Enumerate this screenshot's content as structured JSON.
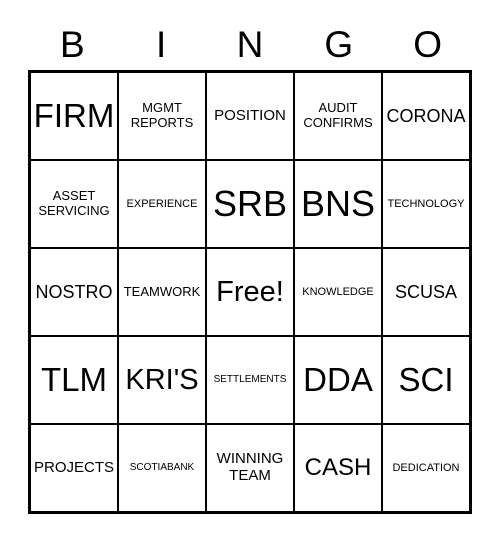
{
  "card": {
    "title": "BINGO",
    "header_letters": [
      "B",
      "I",
      "N",
      "G",
      "O"
    ],
    "free_space_label": "Free!",
    "colors": {
      "background": "#ffffff",
      "border": "#000000",
      "text": "#000000"
    },
    "grid": {
      "columns": 5,
      "rows": 5,
      "cells": [
        {
          "label": "FIRM",
          "size": "fs-4xl",
          "column": "B",
          "row": 1
        },
        {
          "label": "MGMT\nREPORTS",
          "size": "fs-md",
          "column": "I",
          "row": 1
        },
        {
          "label": "POSITION",
          "size": "fs-lg",
          "column": "N",
          "row": 1
        },
        {
          "label": "AUDIT\nCONFIRMS",
          "size": "fs-md",
          "column": "G",
          "row": 1
        },
        {
          "label": "CORONA",
          "size": "fs-xl",
          "column": "O",
          "row": 1
        },
        {
          "label": "ASSET\nSERVICING",
          "size": "fs-md",
          "column": "B",
          "row": 2
        },
        {
          "label": "EXPERIENCE",
          "size": "fs-sm",
          "column": "I",
          "row": 2
        },
        {
          "label": "SRB",
          "size": "fs-5xl",
          "column": "N",
          "row": 2
        },
        {
          "label": "BNS",
          "size": "fs-5xl",
          "column": "G",
          "row": 2
        },
        {
          "label": "TECHNOLOGY",
          "size": "fs-sm",
          "column": "O",
          "row": 2
        },
        {
          "label": "NOSTRO",
          "size": "fs-xl",
          "column": "B",
          "row": 3
        },
        {
          "label": "TEAMWORK",
          "size": "fs-md",
          "column": "I",
          "row": 3
        },
        {
          "label": "Free!",
          "size": "fs-3xl",
          "column": "N",
          "row": 3
        },
        {
          "label": "KNOWLEDGE",
          "size": "fs-sm",
          "column": "G",
          "row": 3
        },
        {
          "label": "SCUSA",
          "size": "fs-xl",
          "column": "O",
          "row": 3
        },
        {
          "label": "TLM",
          "size": "fs-4xl",
          "column": "B",
          "row": 4
        },
        {
          "label": "KRI'S",
          "size": "fs-3xl",
          "column": "I",
          "row": 4
        },
        {
          "label": "SETTLEMENTS",
          "size": "fs-xs",
          "column": "N",
          "row": 4
        },
        {
          "label": "DDA",
          "size": "fs-4xl",
          "column": "G",
          "row": 4
        },
        {
          "label": "SCI",
          "size": "fs-4xl",
          "column": "O",
          "row": 4
        },
        {
          "label": "PROJECTS",
          "size": "fs-lg",
          "column": "B",
          "row": 5
        },
        {
          "label": "SCOTIABANK",
          "size": "fs-xs",
          "column": "I",
          "row": 5
        },
        {
          "label": "WINNING\nTEAM",
          "size": "fs-lg",
          "column": "N",
          "row": 5
        },
        {
          "label": "CASH",
          "size": "fs-2xl",
          "column": "G",
          "row": 5
        },
        {
          "label": "DEDICATION",
          "size": "fs-sm",
          "column": "O",
          "row": 5
        }
      ]
    }
  }
}
